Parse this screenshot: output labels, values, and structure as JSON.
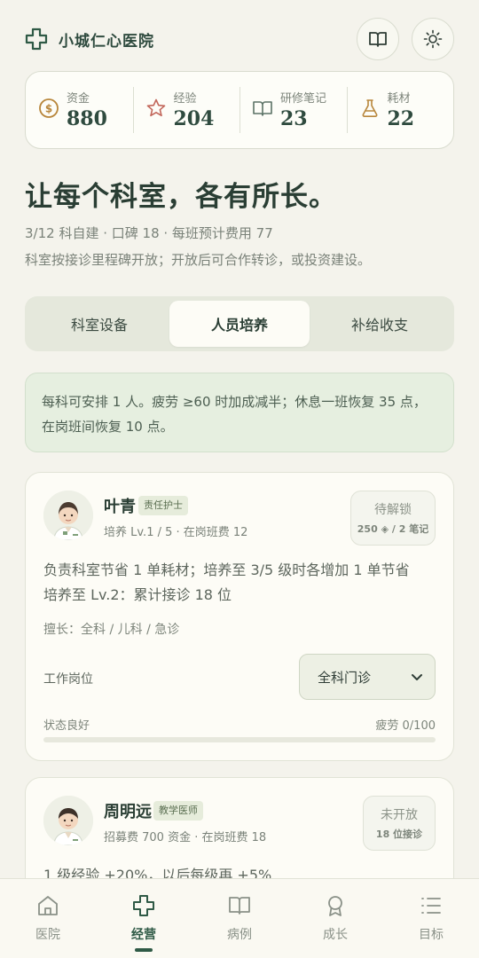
{
  "app": {
    "title": "小城仁心医院"
  },
  "stats": [
    {
      "icon": "coin-icon",
      "label": "资金",
      "value": "880"
    },
    {
      "icon": "star-icon",
      "label": "经验",
      "value": "204"
    },
    {
      "icon": "book-icon",
      "label": "研修笔记",
      "value": "23"
    },
    {
      "icon": "flask-icon",
      "label": "耗材",
      "value": "22"
    }
  ],
  "hero": {
    "title": "让每个科室，各有所长。",
    "meta": "3/12 科自建 · 口碑 18 · 每班预计费用 77",
    "desc": "科室按接诊里程碑开放；开放后可合作转诊，或投资建设。"
  },
  "tabs": [
    {
      "label": "科室设备",
      "active": false
    },
    {
      "label": "人员培养",
      "active": true
    },
    {
      "label": "补给收支",
      "active": false
    }
  ],
  "banner": {
    "line1": "每科可安排 1 人。疲劳 ≥60 时加成减半；休息一班恢复 35 点，",
    "line2": "在岗班间恢复 10 点。"
  },
  "staff": [
    {
      "name": "叶青",
      "role": "责任护士",
      "sub": "培养 Lv.1 / 5 · 在岗班费 12",
      "action_title": "待解锁",
      "action_sub": "250 ◈ / 2 笔记",
      "desc1": "负责科室节省 1 单耗材；培养至 3/5 级时各增加 1 单节省",
      "desc2": "培养至 Lv.2：累计接诊 18 位",
      "skill": "擅长：全科 / 儿科 / 急诊",
      "post_label": "工作岗位",
      "post_value": "全科门诊",
      "status": "状态良好",
      "fatigue": "疲劳 0/100",
      "fatigue_fraction": 0
    },
    {
      "name": "周明远",
      "role": "教学医师",
      "sub": "招募费 700 资金 · 在岗班费 18",
      "action_title": "未开放",
      "action_sub": "18 位接诊",
      "desc1": "1 级经验 +20%，以后每级再 +5%"
    }
  ],
  "nav": [
    {
      "icon": "hospital-icon",
      "label": "医院",
      "active": false
    },
    {
      "icon": "cross-icon",
      "label": "经营",
      "active": true
    },
    {
      "icon": "book-open-icon",
      "label": "病例",
      "active": false
    },
    {
      "icon": "badge-icon",
      "label": "成长",
      "active": false
    },
    {
      "icon": "list-icon",
      "label": "目标",
      "active": false
    }
  ],
  "colors": {
    "accent": "#2f5a46",
    "background": "#f4f3ec",
    "coin": "#b8863b",
    "star": "#c2665a"
  }
}
